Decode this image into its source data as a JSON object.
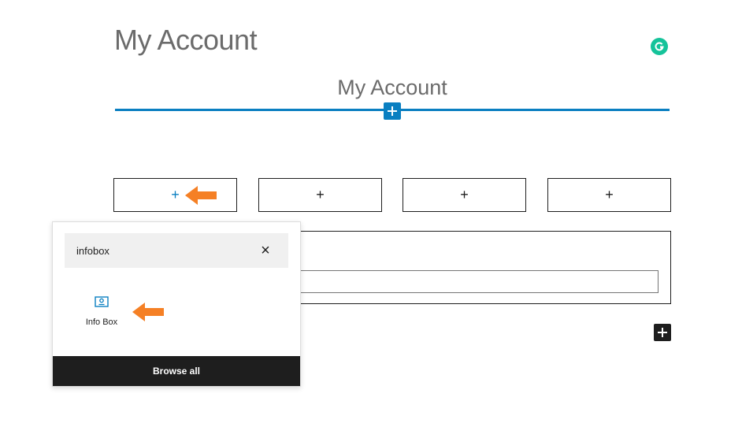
{
  "page": {
    "title": "My Account"
  },
  "heading_block": {
    "text": "My Account"
  },
  "columns": {
    "plus_glyph": "+"
  },
  "inserter": {
    "search": {
      "value": "infobox",
      "clear_glyph": "×"
    },
    "results": [
      {
        "label": "Info Box",
        "icon": "info-box-icon"
      }
    ],
    "browse_all_label": "Browse all"
  },
  "colors": {
    "accent": "#0a7fc1",
    "annotation_arrow": "#f58025",
    "grammarly": "#15c39a",
    "dark": "#1e1e1e"
  }
}
